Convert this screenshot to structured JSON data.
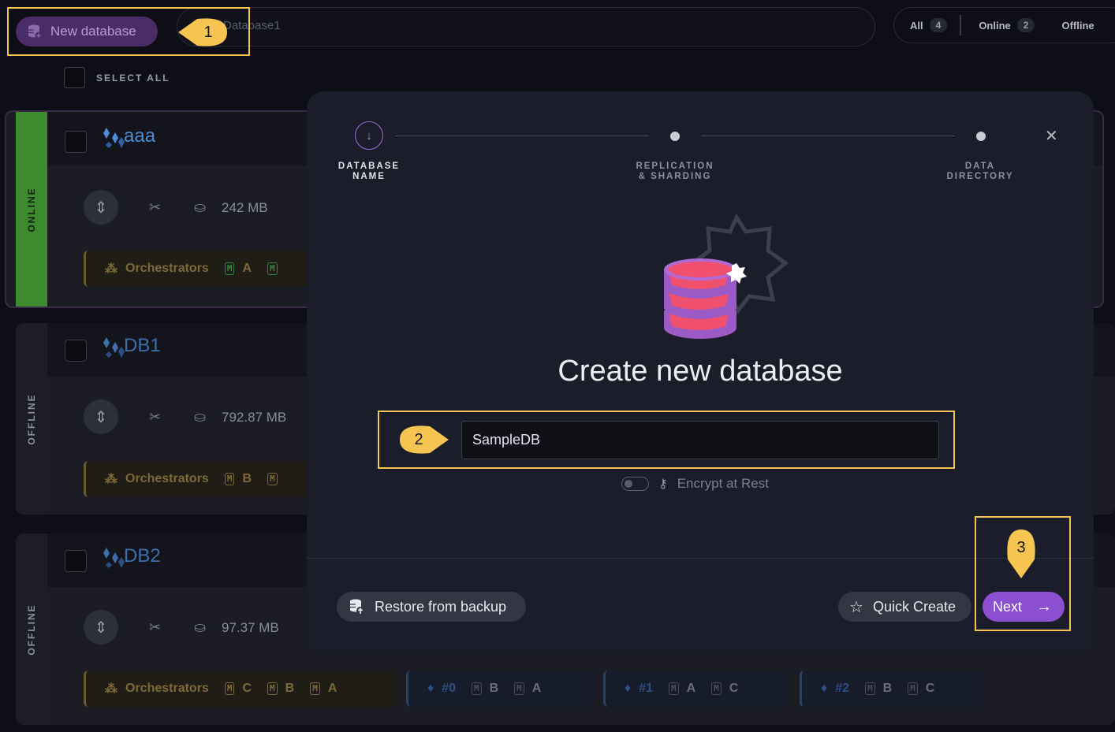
{
  "topbar": {
    "new_database_label": "New database",
    "search_placeholder": "Database1",
    "filters": [
      {
        "label": "All",
        "count": "4"
      },
      {
        "label": "Online",
        "count": "2"
      },
      {
        "label": "Offline",
        "count": ""
      }
    ]
  },
  "select_all_label": "SELECT ALL",
  "databases": [
    {
      "name": "aaa",
      "status": "ONLINE",
      "size": "242 MB",
      "orchestrators": {
        "label": "Orchestrators",
        "nodes": [
          "A"
        ]
      }
    },
    {
      "name": "DB1",
      "status": "OFFLINE",
      "size": "792.87 MB",
      "orchestrators": {
        "label": "Orchestrators",
        "nodes": [
          "B"
        ]
      }
    },
    {
      "name": "DB2",
      "status": "OFFLINE",
      "size": "97.37 MB",
      "orchestrators": {
        "label": "Orchestrators",
        "nodes": [
          "C",
          "B",
          "A"
        ]
      },
      "shards": [
        {
          "label": "#0",
          "nodes": [
            "B",
            "A"
          ]
        },
        {
          "label": "#1",
          "nodes": [
            "A",
            "C"
          ]
        },
        {
          "label": "#2",
          "nodes": [
            "B",
            "C"
          ]
        }
      ]
    }
  ],
  "modal": {
    "steps": [
      {
        "label_line1": "DATABASE",
        "label_line2": "NAME",
        "active": true
      },
      {
        "label_line1": "REPLICATION",
        "label_line2": "& SHARDING",
        "active": false
      },
      {
        "label_line1": "DATA",
        "label_line2": "DIRECTORY",
        "active": false
      }
    ],
    "title": "Create new database",
    "db_name_value": "SampleDB",
    "encrypt_label": "Encrypt at Rest",
    "restore_label": "Restore from backup",
    "quick_create_label": "Quick Create",
    "next_label": "Next"
  },
  "annotations": {
    "markers": [
      "1",
      "2",
      "3"
    ],
    "color": "#f5c451"
  },
  "colors": {
    "accent": "#8b4fd0",
    "online": "#3e8a2e",
    "db_name": "#4e8cd6"
  }
}
